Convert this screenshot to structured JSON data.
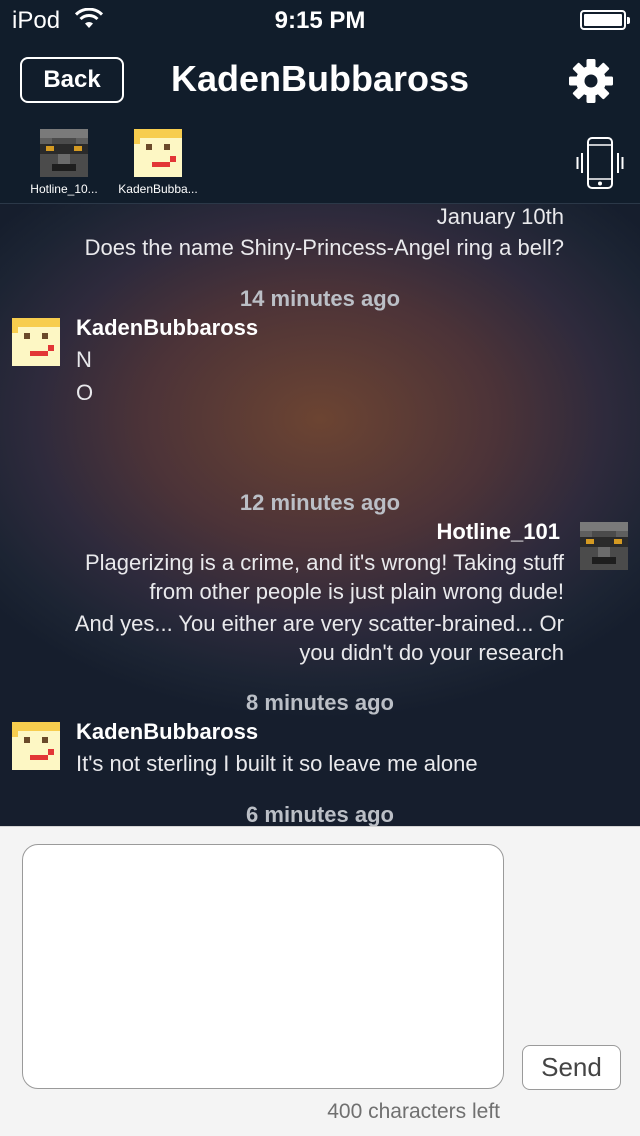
{
  "status_bar": {
    "carrier": "iPod",
    "time": "9:15 PM",
    "battery_level": 1.0
  },
  "nav": {
    "back_label": "Back",
    "title": "KadenBubbaross",
    "settings_icon": "gear-icon"
  },
  "participants": [
    {
      "name": "Hotline_10...",
      "avatar": "dark-pixel-avatar"
    },
    {
      "name": "KadenBubba...",
      "avatar": "yellow-pixel-avatar"
    }
  ],
  "vibrate_icon": "phone-vibrate-icon",
  "chat": {
    "top_partial": {
      "date": "January 10th",
      "text": "Does the name Shiny-Princess-Angel ring a bell?"
    },
    "groups": [
      {
        "timestamp": "14 minutes ago",
        "sender": "KadenBubbaross",
        "lines": [
          "N",
          "O"
        ]
      },
      {
        "timestamp": "12 minutes ago",
        "sender": "Hotline_101",
        "lines": [
          "Plagerizing is a crime, and it's wrong! Taking stuff",
          "from other people is just plain wrong dude!",
          "And yes... You either are very scatter-brained... Or",
          "you didn't do your research"
        ]
      },
      {
        "timestamp": "8 minutes ago",
        "sender": "KadenBubbaross",
        "lines": [
          "It's not sterling I built it so leave me alone"
        ]
      },
      {
        "timestamp": "6 minutes ago"
      }
    ]
  },
  "composer": {
    "value": "",
    "send_label": "Send",
    "chars_left": "400 characters left"
  },
  "colors": {
    "bar_background": "#111d2b",
    "composer_background": "#f4f4f4",
    "timestamp_text": "#bbbfc6"
  }
}
